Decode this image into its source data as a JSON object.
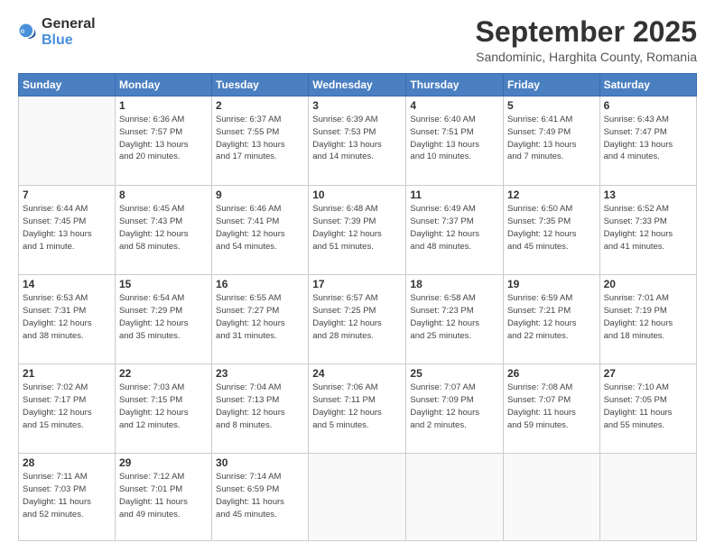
{
  "logo": {
    "general": "General",
    "blue": "Blue"
  },
  "title": "September 2025",
  "subtitle": "Sandominic, Harghita County, Romania",
  "headers": [
    "Sunday",
    "Monday",
    "Tuesday",
    "Wednesday",
    "Thursday",
    "Friday",
    "Saturday"
  ],
  "weeks": [
    [
      {
        "day": "",
        "info": ""
      },
      {
        "day": "1",
        "info": "Sunrise: 6:36 AM\nSunset: 7:57 PM\nDaylight: 13 hours\nand 20 minutes."
      },
      {
        "day": "2",
        "info": "Sunrise: 6:37 AM\nSunset: 7:55 PM\nDaylight: 13 hours\nand 17 minutes."
      },
      {
        "day": "3",
        "info": "Sunrise: 6:39 AM\nSunset: 7:53 PM\nDaylight: 13 hours\nand 14 minutes."
      },
      {
        "day": "4",
        "info": "Sunrise: 6:40 AM\nSunset: 7:51 PM\nDaylight: 13 hours\nand 10 minutes."
      },
      {
        "day": "5",
        "info": "Sunrise: 6:41 AM\nSunset: 7:49 PM\nDaylight: 13 hours\nand 7 minutes."
      },
      {
        "day": "6",
        "info": "Sunrise: 6:43 AM\nSunset: 7:47 PM\nDaylight: 13 hours\nand 4 minutes."
      }
    ],
    [
      {
        "day": "7",
        "info": "Sunrise: 6:44 AM\nSunset: 7:45 PM\nDaylight: 13 hours\nand 1 minute."
      },
      {
        "day": "8",
        "info": "Sunrise: 6:45 AM\nSunset: 7:43 PM\nDaylight: 12 hours\nand 58 minutes."
      },
      {
        "day": "9",
        "info": "Sunrise: 6:46 AM\nSunset: 7:41 PM\nDaylight: 12 hours\nand 54 minutes."
      },
      {
        "day": "10",
        "info": "Sunrise: 6:48 AM\nSunset: 7:39 PM\nDaylight: 12 hours\nand 51 minutes."
      },
      {
        "day": "11",
        "info": "Sunrise: 6:49 AM\nSunset: 7:37 PM\nDaylight: 12 hours\nand 48 minutes."
      },
      {
        "day": "12",
        "info": "Sunrise: 6:50 AM\nSunset: 7:35 PM\nDaylight: 12 hours\nand 45 minutes."
      },
      {
        "day": "13",
        "info": "Sunrise: 6:52 AM\nSunset: 7:33 PM\nDaylight: 12 hours\nand 41 minutes."
      }
    ],
    [
      {
        "day": "14",
        "info": "Sunrise: 6:53 AM\nSunset: 7:31 PM\nDaylight: 12 hours\nand 38 minutes."
      },
      {
        "day": "15",
        "info": "Sunrise: 6:54 AM\nSunset: 7:29 PM\nDaylight: 12 hours\nand 35 minutes."
      },
      {
        "day": "16",
        "info": "Sunrise: 6:55 AM\nSunset: 7:27 PM\nDaylight: 12 hours\nand 31 minutes."
      },
      {
        "day": "17",
        "info": "Sunrise: 6:57 AM\nSunset: 7:25 PM\nDaylight: 12 hours\nand 28 minutes."
      },
      {
        "day": "18",
        "info": "Sunrise: 6:58 AM\nSunset: 7:23 PM\nDaylight: 12 hours\nand 25 minutes."
      },
      {
        "day": "19",
        "info": "Sunrise: 6:59 AM\nSunset: 7:21 PM\nDaylight: 12 hours\nand 22 minutes."
      },
      {
        "day": "20",
        "info": "Sunrise: 7:01 AM\nSunset: 7:19 PM\nDaylight: 12 hours\nand 18 minutes."
      }
    ],
    [
      {
        "day": "21",
        "info": "Sunrise: 7:02 AM\nSunset: 7:17 PM\nDaylight: 12 hours\nand 15 minutes."
      },
      {
        "day": "22",
        "info": "Sunrise: 7:03 AM\nSunset: 7:15 PM\nDaylight: 12 hours\nand 12 minutes."
      },
      {
        "day": "23",
        "info": "Sunrise: 7:04 AM\nSunset: 7:13 PM\nDaylight: 12 hours\nand 8 minutes."
      },
      {
        "day": "24",
        "info": "Sunrise: 7:06 AM\nSunset: 7:11 PM\nDaylight: 12 hours\nand 5 minutes."
      },
      {
        "day": "25",
        "info": "Sunrise: 7:07 AM\nSunset: 7:09 PM\nDaylight: 12 hours\nand 2 minutes."
      },
      {
        "day": "26",
        "info": "Sunrise: 7:08 AM\nSunset: 7:07 PM\nDaylight: 11 hours\nand 59 minutes."
      },
      {
        "day": "27",
        "info": "Sunrise: 7:10 AM\nSunset: 7:05 PM\nDaylight: 11 hours\nand 55 minutes."
      }
    ],
    [
      {
        "day": "28",
        "info": "Sunrise: 7:11 AM\nSunset: 7:03 PM\nDaylight: 11 hours\nand 52 minutes."
      },
      {
        "day": "29",
        "info": "Sunrise: 7:12 AM\nSunset: 7:01 PM\nDaylight: 11 hours\nand 49 minutes."
      },
      {
        "day": "30",
        "info": "Sunrise: 7:14 AM\nSunset: 6:59 PM\nDaylight: 11 hours\nand 45 minutes."
      },
      {
        "day": "",
        "info": ""
      },
      {
        "day": "",
        "info": ""
      },
      {
        "day": "",
        "info": ""
      },
      {
        "day": "",
        "info": ""
      }
    ]
  ]
}
